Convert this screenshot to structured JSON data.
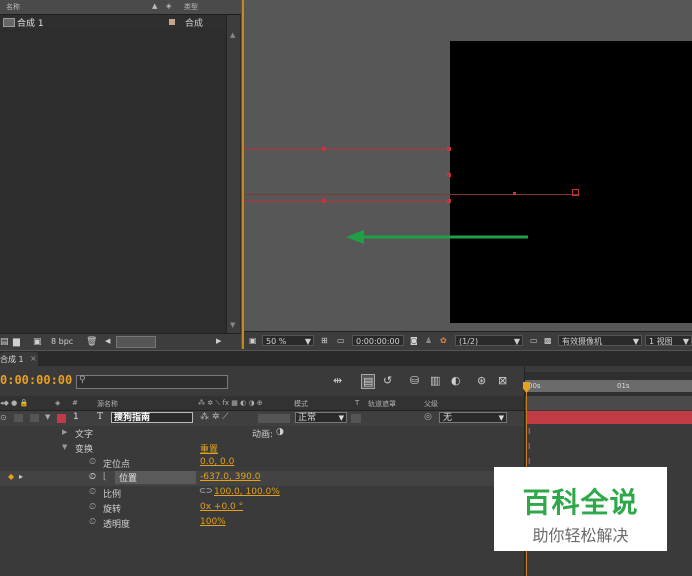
{
  "project": {
    "col_name": "名称",
    "col_type": "类型",
    "item_name": "合成 1",
    "item_type": "合成",
    "bpc": "8 bpc"
  },
  "viewer": {
    "zoom": "50 %",
    "timecode": "0:00:00:00",
    "resolution": "(1/2)",
    "camera": "有效摄像机",
    "views": "1 视图"
  },
  "timeline": {
    "tab_label": "合成 1",
    "timecode": "0:00:00:00",
    "ruler_start": "00s",
    "ruler_1s": "01s",
    "columns": {
      "num": "#",
      "source": "源名称",
      "mode": "模式",
      "trkmat": "轨道遮罩",
      "parent": "父级"
    },
    "layer": {
      "index": "1",
      "type": "T",
      "name": "搜狗指南",
      "mode": "正常",
      "parent": "无"
    },
    "rows": {
      "text": "文字",
      "animate": "动画:",
      "transform": "变换",
      "reset": "重置",
      "anchor_label": "定位点",
      "anchor_value": "0.0, 0.0",
      "position_label": "位置",
      "position_value": "-637.0, 390.0",
      "scale_label": "比例",
      "scale_value": "100.0, 100.0%",
      "rotation_label": "旋转",
      "rotation_value": "0x +0.0 °",
      "opacity_label": "透明度",
      "opacity_value": "100%"
    }
  },
  "watermark": {
    "title": "百科全说",
    "subtitle": "助你轻松解决"
  },
  "colors": {
    "timecode": "#e8a020",
    "value": "#e3a21a",
    "layer_bar": "#c13b45",
    "arrow": "#1fa046",
    "motion_path": "#b8343a"
  }
}
